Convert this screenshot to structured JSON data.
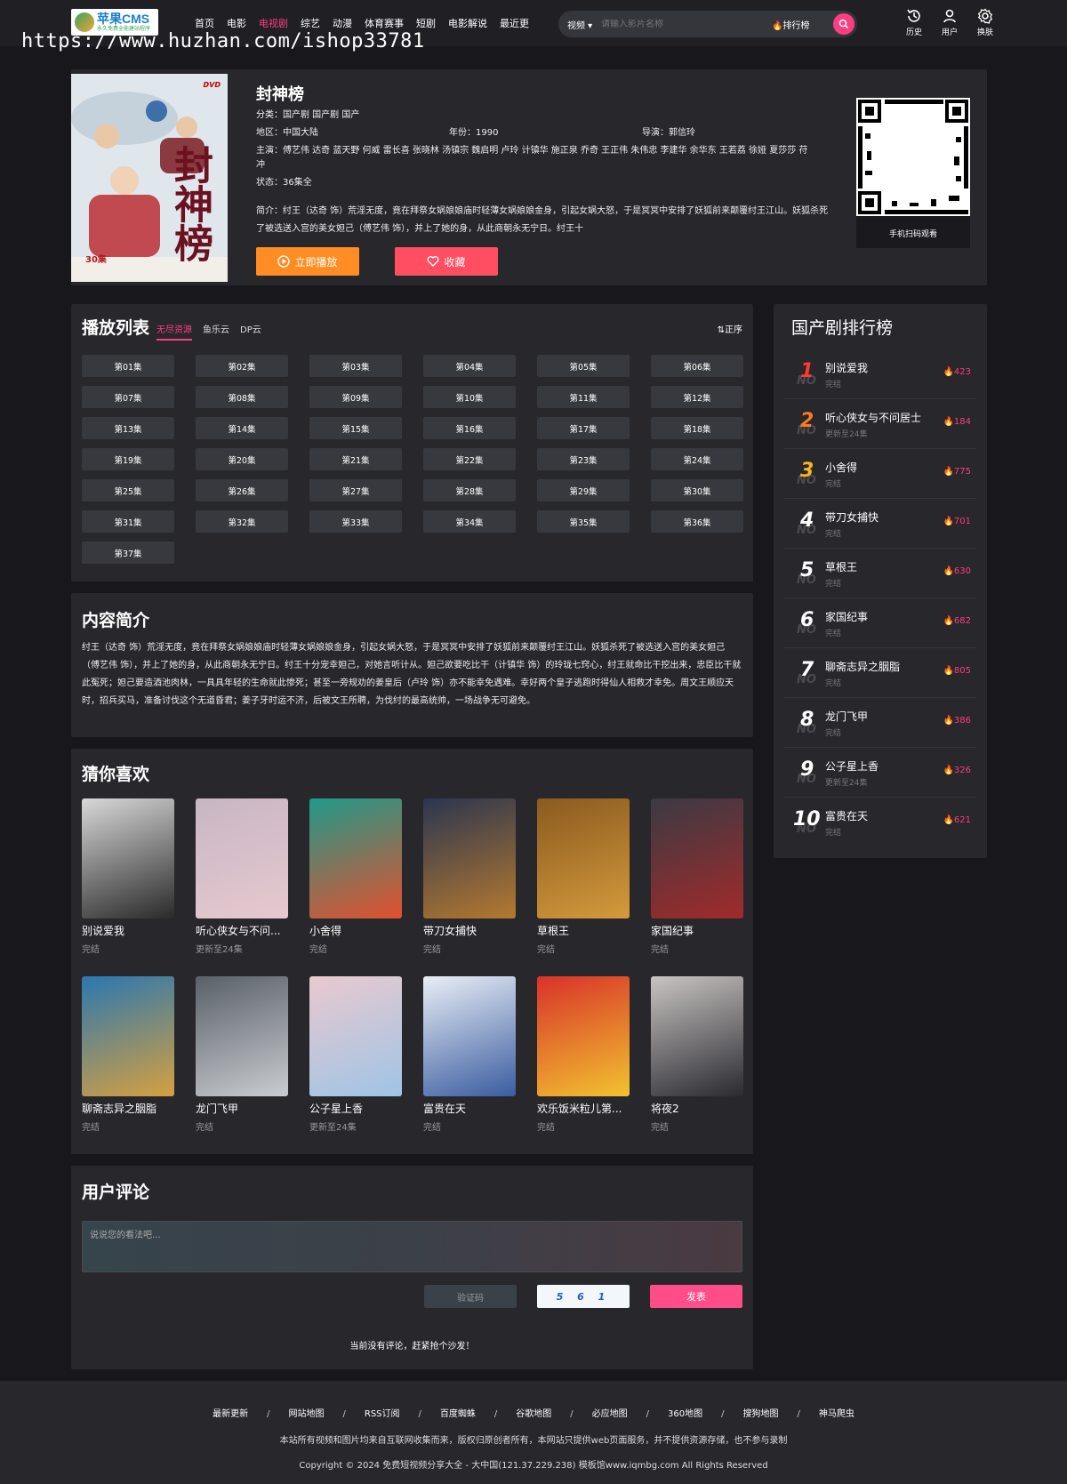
{
  "header": {
    "logo_main": "苹果CMS",
    "logo_sub": "永久免费全能建站程序",
    "watermark": "https://www.huzhan.com/ishop33781",
    "nav": [
      "首页",
      "电影",
      "电视剧",
      "综艺",
      "动漫",
      "体育赛事",
      "短剧",
      "电影解说",
      "最近更"
    ],
    "active_nav": "电视剧",
    "search_type": "视频",
    "search_placeholder": "请输入影片名称",
    "rank_link": "排行榜",
    "tools": {
      "history": "历史",
      "user": "用户",
      "skin": "换肤"
    }
  },
  "detail": {
    "title": "封神榜",
    "category_label": "分类：",
    "category": "国产剧 国产剧 国产",
    "region_label": "地区：",
    "region": "中国大陆",
    "year_label": "年份：",
    "year": "1990",
    "director_label": "导演：",
    "director": "郭信玲",
    "cast_label": "主演：",
    "cast": "傅艺伟 达奇 蓝天野 何威 雷长喜 张晓林 汤镇宗 魏启明 卢玲 计镇华 施正泉 乔奇 王正伟 朱伟忠 李建华 余华东 王若荔 徐娅 夏莎莎 苻冲",
    "status_label": "状态：",
    "status": "36集全",
    "summary_label": "简介：",
    "summary": "纣王（达奇 饰）荒淫无度，竟在拜祭女娲娘娘庙时轻薄女娲娘娘金身，引起女娲大怒，于是冥冥中安排了妖狐前来颠覆纣王江山。妖狐杀死了被选送入宫的美女妲己（傅艺伟 饰），并上了她的身，从此商朝永无宁日。纣王十",
    "play_label": "立即播放",
    "fav_label": "收藏",
    "qr_label": "手机扫码观看",
    "poster_title": "封神榜",
    "poster_badge": "DVD",
    "poster_episodes": "30集"
  },
  "playlist": {
    "title": "播放列表",
    "sources": [
      "无尽资源",
      "鱼乐云",
      "DP云"
    ],
    "active_source": "无尽资源",
    "sort_label": "正序",
    "episodes": [
      "第01集",
      "第02集",
      "第03集",
      "第04集",
      "第05集",
      "第06集",
      "第07集",
      "第08集",
      "第09集",
      "第10集",
      "第11集",
      "第12集",
      "第13集",
      "第14集",
      "第15集",
      "第16集",
      "第17集",
      "第18集",
      "第19集",
      "第20集",
      "第21集",
      "第22集",
      "第23集",
      "第24集",
      "第25集",
      "第26集",
      "第27集",
      "第28集",
      "第29集",
      "第30集",
      "第31集",
      "第32集",
      "第33集",
      "第34集",
      "第35集",
      "第36集",
      "第37集"
    ]
  },
  "intro": {
    "title": "内容简介",
    "text": "纣王（达奇 饰）荒淫无度，竟在拜祭女娲娘娘庙时轻薄女娲娘娘金身，引起女娲大怒，于是冥冥中安排了妖狐前来颠覆纣王江山。妖狐杀死了被选送入宫的美女妲己（傅艺伟 饰），并上了她的身，从此商朝永无宁日。纣王十分宠幸妲己，对她言听计从。妲己欲要吃比干（计镇华 饰）的玲珑七窍心，纣王就命比干挖出来，忠臣比干就此冤死；妲己要造酒池肉林，一具具年轻的生命就此惨死；甚至一旁规劝的姜皇后（卢玲 饰）亦不能幸免遇难。幸好两个皇子逃跑时得仙人相救才幸免。周文王顺应天时，招兵买马，准备讨伐这个无道昏君；姜子牙时运不济，后被文王所聘，为伐纣的最高统帅，一场战争无可避免。"
  },
  "guess": {
    "title": "猜你喜欢",
    "items": [
      {
        "name": "别说爱我",
        "status": "完结",
        "c1": "#d8d8d8",
        "c2": "#2a2a2a"
      },
      {
        "name": "听心侠女与不问...",
        "status": "更新至24集",
        "c1": "#c8b6c4",
        "c2": "#e6c9cf"
      },
      {
        "name": "小舍得",
        "status": "完结",
        "c1": "#1f9a8a",
        "c2": "#e2502e"
      },
      {
        "name": "带刀女捕快",
        "status": "完结",
        "c1": "#2b3550",
        "c2": "#b5792f"
      },
      {
        "name": "草根王",
        "status": "完结",
        "c1": "#8a5a20",
        "c2": "#d49a3c"
      },
      {
        "name": "家国纪事",
        "status": "完结",
        "c1": "#3a3a44",
        "c2": "#a22a2a"
      },
      {
        "name": "聊斋志异之胭脂",
        "status": "完结",
        "c1": "#2a77b0",
        "c2": "#d6a040"
      },
      {
        "name": "龙门飞甲",
        "status": "完结",
        "c1": "#5a6068",
        "c2": "#c9ccd0"
      },
      {
        "name": "公子星上香",
        "status": "更新至24集",
        "c1": "#e9c9cf",
        "c2": "#9fc4e6"
      },
      {
        "name": "富贵在天",
        "status": "完结",
        "c1": "#e9eef6",
        "c2": "#3a5ca0"
      },
      {
        "name": "欢乐饭米粒儿第...",
        "status": "完结",
        "c1": "#d8322a",
        "c2": "#f2c230"
      },
      {
        "name": "将夜2",
        "status": "完结",
        "c1": "#c8c4c2",
        "c2": "#2a2a30"
      }
    ]
  },
  "comment": {
    "title": "用户评论",
    "placeholder": "说说您的看法吧...",
    "vcode_placeholder": "验证码",
    "vcode_image": "5 6 1",
    "send_label": "发表",
    "empty": "当前没有评论，赶紧抢个沙发！"
  },
  "rank": {
    "title": "国产剧排行榜",
    "items": [
      {
        "no": "1",
        "name": "别说爱我",
        "status": "完结",
        "hot": "423",
        "color": "#ff3a2e"
      },
      {
        "no": "2",
        "name": "听心侠女与不问居士",
        "status": "更新至24集",
        "hot": "184",
        "color": "#ff7a1f"
      },
      {
        "no": "3",
        "name": "小舍得",
        "status": "完结",
        "hot": "775",
        "color": "#f5b71a"
      },
      {
        "no": "4",
        "name": "带刀女捕快",
        "status": "完结",
        "hot": "701",
        "color": "#ffffff"
      },
      {
        "no": "5",
        "name": "草根王",
        "status": "完结",
        "hot": "630",
        "color": "#ffffff"
      },
      {
        "no": "6",
        "name": "家国纪事",
        "status": "完结",
        "hot": "682",
        "color": "#ffffff"
      },
      {
        "no": "7",
        "name": "聊斋志异之胭脂",
        "status": "完结",
        "hot": "805",
        "color": "#ffffff"
      },
      {
        "no": "8",
        "name": "龙门飞甲",
        "status": "完结",
        "hot": "386",
        "color": "#ffffff"
      },
      {
        "no": "9",
        "name": "公子星上香",
        "status": "更新至24集",
        "hot": "326",
        "color": "#ffffff"
      },
      {
        "no": "10",
        "name": "富贵在天",
        "status": "完结",
        "hot": "621",
        "color": "#ffffff"
      }
    ],
    "no_label": "NO"
  },
  "footer": {
    "links": [
      "最新更新",
      "网站地图",
      "RSS订阅",
      "百度蜘蛛",
      "谷歌地图",
      "必应地图",
      "360地图",
      "搜狗地图",
      "神马爬虫"
    ],
    "separator": "/",
    "note": "本站所有视频和图片均来自互联网收集而来，版权归原创者所有，本网站只提供web页面服务，并不提供资源存储，也不参与录制",
    "copyright": "Copyright © 2024 免费短视频分享大全 - 大中国(121.37.229.238) 模板馆www.iqmbg.com All Rights Reserved"
  },
  "colors": {
    "accent": "#ff3d7f",
    "orange": "#ff8d23",
    "fav": "#ff4d62",
    "panel": "#27272c",
    "bg": "#18181c"
  }
}
